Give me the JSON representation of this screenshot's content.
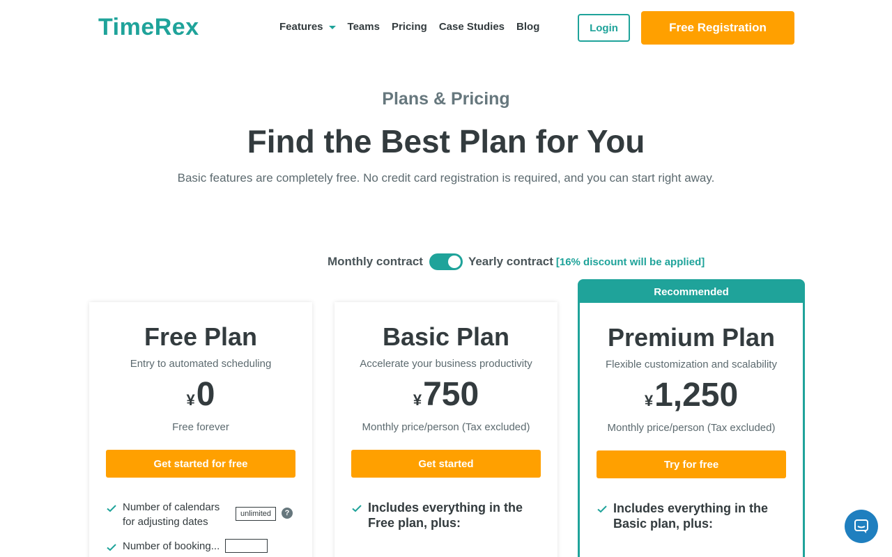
{
  "header": {
    "logo": "TimeRex",
    "nav": [
      "Features",
      "Teams",
      "Pricing",
      "Case Studies",
      "Blog"
    ],
    "login_label": "Login",
    "register_label": "Free Registration"
  },
  "hero": {
    "eyebrow": "Plans & Pricing",
    "title": "Find the Best Plan for You",
    "subtitle": "Basic features are completely free. No credit card registration is required, and you can start right away."
  },
  "billing": {
    "monthly_label": "Monthly contract",
    "yearly_label": "Yearly contract",
    "discount_label": "[16% discount will be applied]",
    "yearly_selected": true
  },
  "plans": [
    {
      "name": "Free Plan",
      "tagline": "Entry to automated scheduling",
      "currency": "¥",
      "price": "0",
      "price_note": "Free forever",
      "cta": "Get started for free",
      "feature": "Number of calendars for adjusting dates",
      "feature_badge": "unlimited",
      "help_icon": "question-icon",
      "feature2": "Number of booking..."
    },
    {
      "name": "Basic Plan",
      "tagline": "Accelerate your business productivity",
      "currency": "¥",
      "price": "750",
      "price_note": "Monthly price/person (Tax excluded)",
      "cta": "Get started",
      "feature": "Includes everything in the Free plan, plus:"
    },
    {
      "name": "Premium Plan",
      "badge": "Recommended",
      "tagline": "Flexible customization and scalability",
      "currency": "¥",
      "price": "1,250",
      "price_note": "Monthly price/person (Tax excluded)",
      "cta": "Try for free",
      "feature": "Includes everything in the Basic plan, plus:"
    }
  ],
  "colors": {
    "brand": "#1fa39a",
    "cta": "#ffa000",
    "chat": "#1f7fbf"
  },
  "chat_icon": "chat-bubble-icon"
}
